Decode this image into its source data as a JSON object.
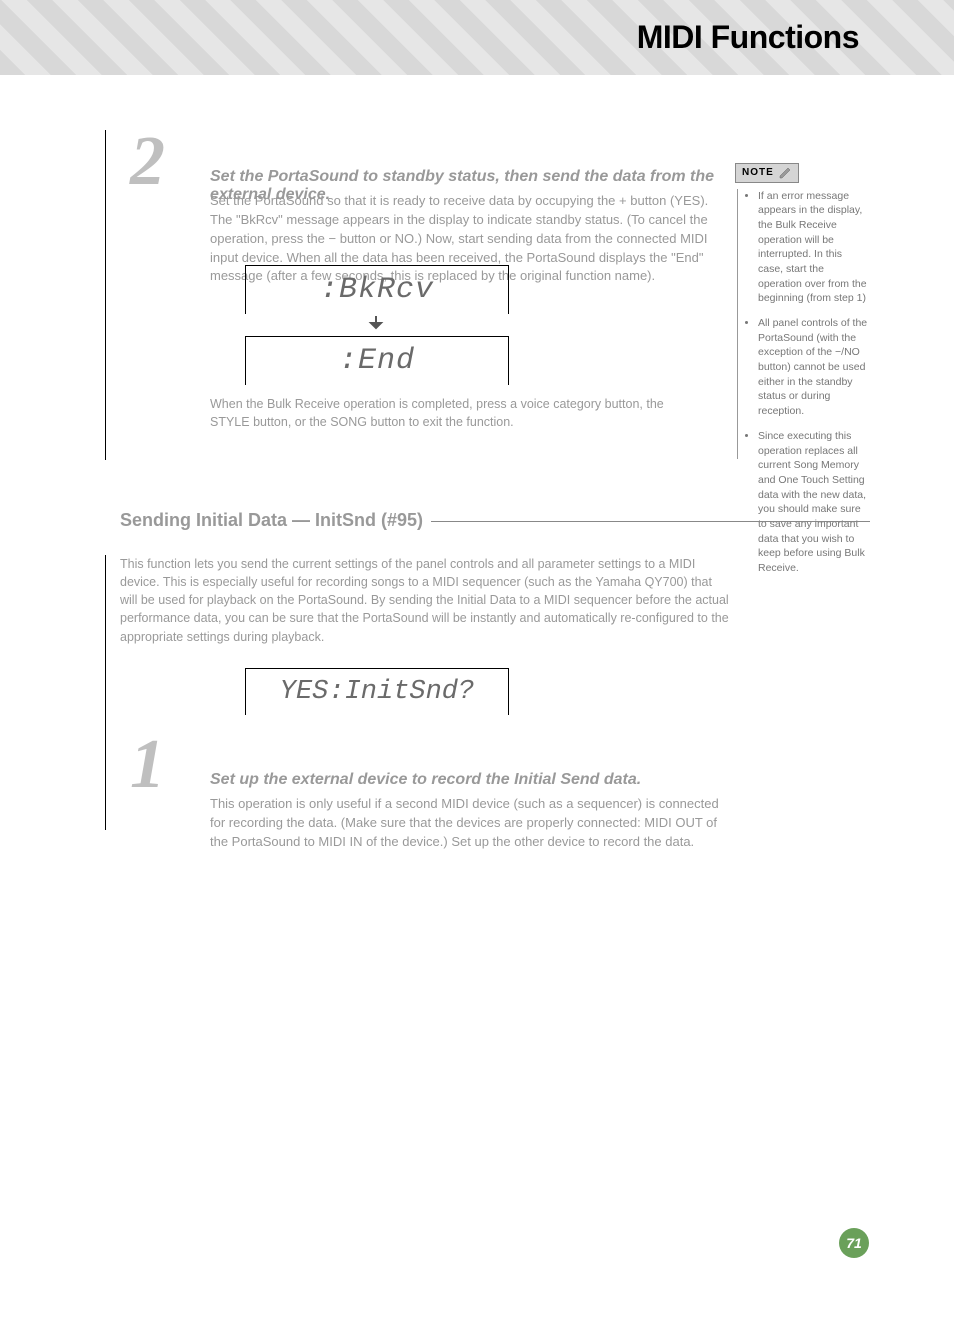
{
  "header": {
    "title": "MIDI Functions"
  },
  "step2": {
    "number": "2",
    "label": "Set the PortaSound to standby status, then send the data from the external device.",
    "body": "Set the PortaSound so that it is ready to receive data by occupying the + button (YES). The \"BkRcv\" message appears in the display to indicate standby status. (To cancel the operation, press the − button or NO.) Now, start sending data from the connected MIDI input device. When all the data has been received, the PortaSound displays the \"End\" message (after a few seconds, this is replaced by the original function name).",
    "lcd1": ":BkRcv",
    "lcd2": ":End",
    "post": "When the Bulk Receive operation is completed, press a voice category button, the STYLE button, or the SONG button to exit the function."
  },
  "note": {
    "tag": "NOTE",
    "items": [
      "If an error message appears in the display, the Bulk Receive operation will be interrupted. In this case, start the operation over from the beginning (from step 1)",
      "All panel controls of the PortaSound (with the exception of the −/NO button) cannot be used either in the standby status or during reception.",
      "Since executing this operation replaces all current Song Memory and One Touch Setting data with the new data, you should make sure to save any important data that you wish to keep before using Bulk Receive."
    ]
  },
  "section": {
    "title": "Sending Initial Data — InitSnd (#95)"
  },
  "initsnd": {
    "intro": "This function lets you send the current settings of the panel controls and all parameter settings to a MIDI device. This is especially useful for recording songs to a MIDI sequencer (such as the Yamaha QY700) that will be used for playback on the PortaSound. By sending the Initial Data to a MIDI sequencer before the actual performance data, you can be sure that the PortaSound will be instantly and automatically re-configured to the appropriate settings during playback.",
    "lcd": "YES:InitSnd?"
  },
  "step1": {
    "number": "1",
    "label": "Set up the external device to record the Initial Send data.",
    "body": "This operation is only useful if a second MIDI device (such as a sequencer) is connected for recording the data. (Make sure that the devices are properly connected: MIDI OUT of the PortaSound to MIDI IN of the device.) Set up the other device to record the data."
  },
  "page_number": "71"
}
